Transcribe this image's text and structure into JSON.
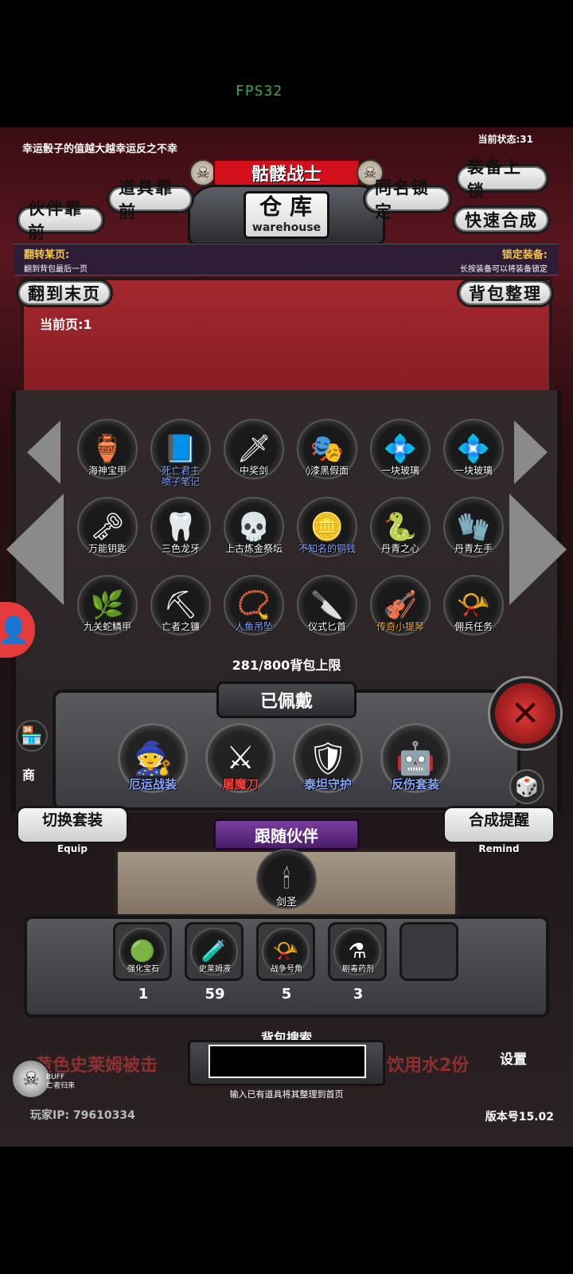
{
  "status": {
    "fps": "FPS32"
  },
  "top": {
    "tip": "幸运骰子的值越大越幸运反之不幸",
    "duration": "当前状态:31",
    "title": "骷髅战士",
    "warehouse_cn": "仓库",
    "warehouse_en": "warehouse"
  },
  "buttons": {
    "items_front": "道具靠前",
    "partner_front": "伙伴靠前",
    "name_lock": "同名锁定",
    "equip_lock": "装备上锁",
    "quick_merge": "快速合成",
    "last_page": "翻到末页",
    "sort_bag": "背包整理"
  },
  "info_bar": {
    "flip_title": "翻转某页:",
    "flip_desc": "翻到背包最后一页",
    "lock_title": "锁定装备:",
    "lock_desc": "长按装备可以将装备锁定"
  },
  "current_page": "当前页:1",
  "items": [
    {
      "name": "海神宝甲",
      "icon": "🏺",
      "color": "white"
    },
    {
      "name": "死亡君主\n喷子笔记",
      "icon": "📘",
      "color": "blue"
    },
    {
      "name": "中奖剑",
      "icon": "🗡",
      "color": "white"
    },
    {
      "name": "◊漆黑假面",
      "icon": "🎭",
      "color": "white"
    },
    {
      "name": "一块玻璃",
      "icon": "💠",
      "color": "white"
    },
    {
      "name": "一块玻璃",
      "icon": "💠",
      "color": "white"
    },
    {
      "name": "万能钥匙",
      "icon": "🗝",
      "color": "white"
    },
    {
      "name": "三色龙牙",
      "icon": "🦷",
      "color": "white"
    },
    {
      "name": "上古炼金祭坛",
      "icon": "💀",
      "color": "white"
    },
    {
      "name": "不知名的铜钱",
      "icon": "🪙",
      "color": "blue"
    },
    {
      "name": "丹青之心",
      "icon": "🐍",
      "color": "white"
    },
    {
      "name": "丹青左手",
      "icon": "🧤",
      "color": "white"
    },
    {
      "name": "九关蛇鳞甲",
      "icon": "🌿",
      "color": "white"
    },
    {
      "name": "亡者之镰",
      "icon": "⛏",
      "color": "white"
    },
    {
      "name": "人鱼吊坠",
      "icon": "📿",
      "color": "blue"
    },
    {
      "name": "仪式匕首",
      "icon": "🔪",
      "color": "white"
    },
    {
      "name": "传奇小提琴",
      "icon": "🎻",
      "color": "orange"
    },
    {
      "name": "佣兵任务",
      "icon": "📯",
      "color": "white"
    }
  ],
  "capacity": "281/800背包上限",
  "equipped": {
    "title": "已佩戴",
    "slots": [
      {
        "name": "厄运战装",
        "icon": "🧙",
        "color": "blue"
      },
      {
        "name": "屠魔刀",
        "icon": "⚔",
        "color": "red"
      },
      {
        "name": "泰坦守护",
        "icon": "🛡",
        "color": "blue"
      },
      {
        "name": "反伤套装",
        "icon": "🤖",
        "color": "blue"
      }
    ]
  },
  "switch_set": {
    "label": "切换套装",
    "sub": "Equip"
  },
  "merge_remind": {
    "label": "合成提醒",
    "sub": "Remind"
  },
  "partner": {
    "title": "跟随伙伴",
    "name": "剑圣",
    "icon": "🕯"
  },
  "consumables": [
    {
      "name": "强化宝石",
      "icon": "🟢",
      "qty": "1"
    },
    {
      "name": "史莱姆液",
      "icon": "🧪",
      "qty": "59"
    },
    {
      "name": "战争号角",
      "icon": "📯",
      "qty": "5"
    },
    {
      "name": "剧毒药剂",
      "icon": "⚗",
      "qty": "3"
    }
  ],
  "search": {
    "title": "背包搜索",
    "value": "",
    "hint": "输入已有道具将其整理到首页"
  },
  "footer": {
    "scroll_left": "黄色史莱姆被击",
    "scroll_right": "饮用水2份",
    "ip": "玩家IP: 79610334",
    "version": "版本号15.02",
    "buff_label": "BUFF\n亡者归来",
    "settings": "设置",
    "shop": "商"
  },
  "colors": {
    "accent_red": "#d2101c",
    "item_blue": "#88a8ff",
    "item_orange": "#ffb13d",
    "fps_green": "#2fae4a"
  }
}
